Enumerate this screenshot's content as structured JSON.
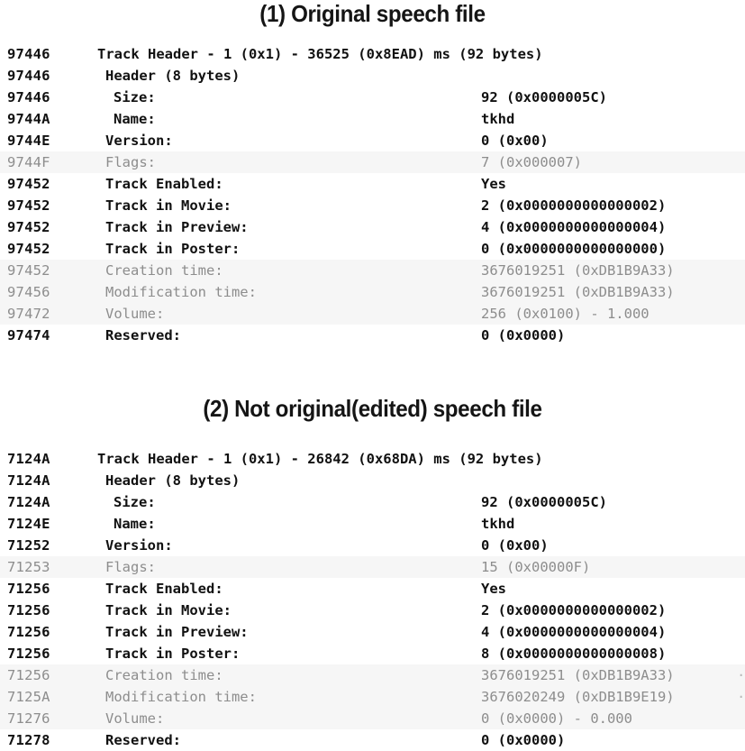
{
  "page": {
    "background_color": "#ffffff",
    "text_color": "#111111",
    "dim_text_color": "#8d8d8d",
    "dim_row_background": "#f6f6f6"
  },
  "sections": [
    {
      "title": "(1) Original speech file",
      "rows": [
        {
          "address": "97446",
          "indent": 0,
          "label": "Track Header - 1 (0x1) - 36525 (0x8EAD) ms (92 bytes)",
          "value": "",
          "dim": false
        },
        {
          "address": "97446",
          "indent": 1,
          "label": "Header (8 bytes)",
          "value": "",
          "dim": false
        },
        {
          "address": "97446",
          "indent": 2,
          "label": "Size:",
          "value": "92 (0x0000005C)",
          "dim": false
        },
        {
          "address": "9744A",
          "indent": 2,
          "label": "Name:",
          "value": "tkhd",
          "dim": false
        },
        {
          "address": "9744E",
          "indent": 1,
          "label": "Version:",
          "value": "0 (0x00)",
          "dim": false
        },
        {
          "address": "9744F",
          "indent": 1,
          "label": "Flags:",
          "value": "7 (0x000007)",
          "dim": true
        },
        {
          "address": "97452",
          "indent": 1,
          "label": "Track Enabled:",
          "value": "Yes",
          "dim": false
        },
        {
          "address": "97452",
          "indent": 1,
          "label": "Track in Movie:",
          "value": "2 (0x0000000000000002)",
          "dim": false
        },
        {
          "address": "97452",
          "indent": 1,
          "label": "Track in Preview:",
          "value": "4 (0x0000000000000004)",
          "dim": false
        },
        {
          "address": "97452",
          "indent": 1,
          "label": "Track in Poster:",
          "value": "0 (0x0000000000000000)",
          "dim": false
        },
        {
          "address": "97452",
          "indent": 1,
          "label": "Creation time:",
          "value": "3676019251 (0xDB1B9A33)",
          "dim": true
        },
        {
          "address": "97456",
          "indent": 1,
          "label": "Modification time:",
          "value": "3676019251 (0xDB1B9A33)",
          "dim": true
        },
        {
          "address": "97472",
          "indent": 1,
          "label": "Volume:",
          "value": "256 (0x0100) - 1.000",
          "dim": true
        },
        {
          "address": "97474",
          "indent": 1,
          "label": "Reserved:",
          "value": "0 (0x0000)",
          "dim": false
        }
      ]
    },
    {
      "title": "(2) Not original(edited) speech file",
      "rows": [
        {
          "address": "7124A",
          "indent": 0,
          "label": "Track Header - 1 (0x1) - 26842 (0x68DA) ms (92 bytes)",
          "value": "",
          "dim": false
        },
        {
          "address": "7124A",
          "indent": 1,
          "label": "Header (8 bytes)",
          "value": "",
          "dim": false
        },
        {
          "address": "7124A",
          "indent": 2,
          "label": "Size:",
          "value": "92 (0x0000005C)",
          "dim": false
        },
        {
          "address": "7124E",
          "indent": 2,
          "label": "Name:",
          "value": "tkhd",
          "dim": false
        },
        {
          "address": "71252",
          "indent": 1,
          "label": "Version:",
          "value": "0 (0x00)",
          "dim": false
        },
        {
          "address": "71253",
          "indent": 1,
          "label": "Flags:",
          "value": "15 (0x00000F)",
          "dim": true
        },
        {
          "address": "71256",
          "indent": 1,
          "label": "Track Enabled:",
          "value": "Yes",
          "dim": false
        },
        {
          "address": "71256",
          "indent": 1,
          "label": "Track in Movie:",
          "value": "2 (0x0000000000000002)",
          "dim": false
        },
        {
          "address": "71256",
          "indent": 1,
          "label": "Track in Preview:",
          "value": "4 (0x0000000000000004)",
          "dim": false
        },
        {
          "address": "71256",
          "indent": 1,
          "label": "Track in Poster:",
          "value": "8 (0x0000000000000008)",
          "dim": false
        },
        {
          "address": "71256",
          "indent": 1,
          "label": "Creation time:",
          "value": "3676019251 (0xDB1B9A33)",
          "dim": true
        },
        {
          "address": "7125A",
          "indent": 1,
          "label": "Modification time:",
          "value": "3676020249 (0xDB1B9E19)",
          "dim": true
        },
        {
          "address": "71276",
          "indent": 1,
          "label": "Volume:",
          "value": "0 (0x0000) - 0.000",
          "dim": true
        },
        {
          "address": "71278",
          "indent": 1,
          "label": "Reserved:",
          "value": "0 (0x0000)",
          "dim": false
        }
      ]
    }
  ]
}
